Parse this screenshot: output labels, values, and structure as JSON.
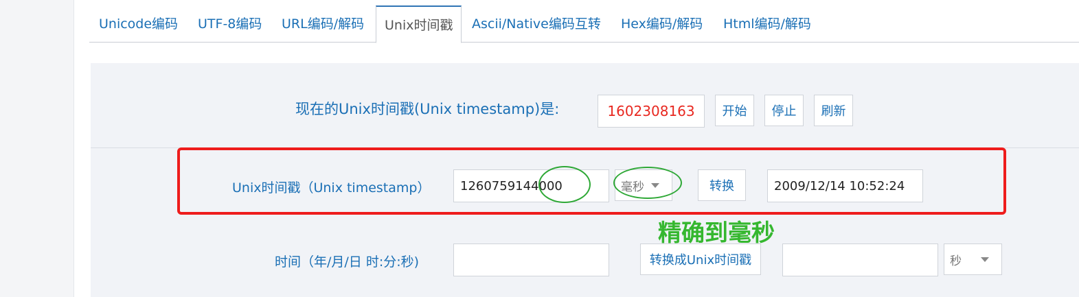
{
  "tabs": [
    {
      "label": "Unicode编码"
    },
    {
      "label": "UTF-8编码"
    },
    {
      "label": "URL编码/解码"
    },
    {
      "label": "Unix时间戳"
    },
    {
      "label": "Ascii/Native编码互转"
    },
    {
      "label": "Hex编码/解码"
    },
    {
      "label": "Html编码/解码"
    }
  ],
  "current": {
    "label": "现在的Unix时间戳(Unix timestamp)是:",
    "value": "1602308163",
    "start": "开始",
    "stop": "停止",
    "refresh": "刷新"
  },
  "ts_to_date": {
    "label": "Unix时间戳（Unix timestamp）",
    "input_value": "1260759144000",
    "unit": "毫秒",
    "convert": "转换",
    "result": "2009/12/14 10:52:24"
  },
  "date_to_ts": {
    "label": "时间（年/月/日 时:分:秒)",
    "input_value": "",
    "convert": "转换成Unix时间戳",
    "result": "",
    "unit": "秒"
  },
  "annotation": {
    "text": "精确到毫秒"
  },
  "colors": {
    "accent": "#1a6fb5",
    "current_value": "#e8271f",
    "annotation_red": "#ee1c1c",
    "annotation_green": "#2ea836"
  }
}
